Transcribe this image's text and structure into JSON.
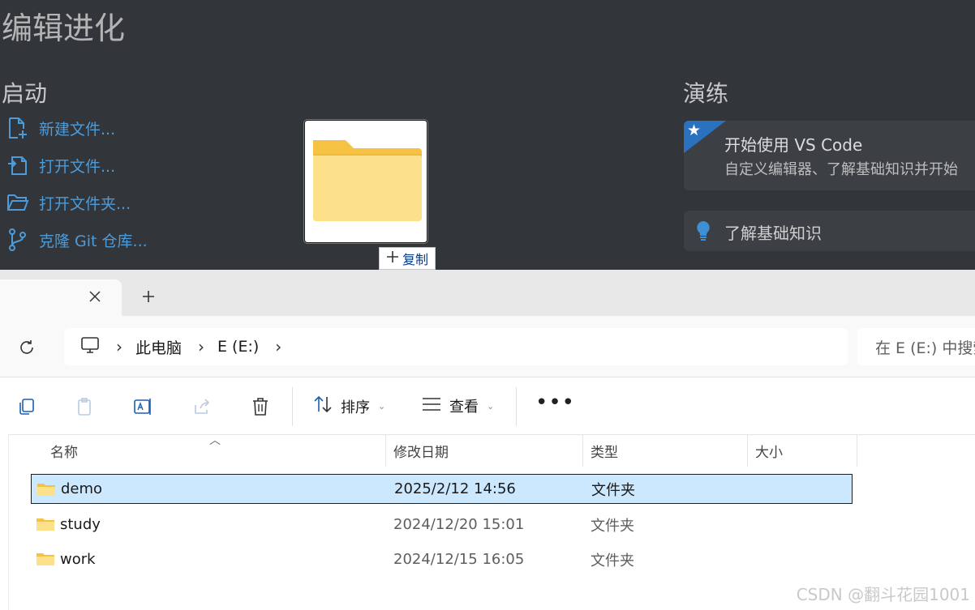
{
  "vscode": {
    "title": "编辑进化",
    "start_heading": "启动",
    "start_items": [
      {
        "label": "新建文件...",
        "icon": "new-file-icon"
      },
      {
        "label": "打开文件...",
        "icon": "open-file-icon"
      },
      {
        "label": "打开文件夹...",
        "icon": "open-folder-icon"
      },
      {
        "label": "克隆 Git 仓库...",
        "icon": "git-branch-icon"
      }
    ],
    "walkthrough_heading": "演练",
    "walkthrough_card": {
      "title": "开始使用 VS Code",
      "description": "自定义编辑器、了解基础知识并开始"
    },
    "walkthrough_card2": {
      "title": "了解基础知识"
    },
    "drag_copy_label": "复制",
    "link_color": "#4d9bd8",
    "background": "#32363b"
  },
  "explorer": {
    "breadcrumb": [
      "此电脑",
      "E (E:)"
    ],
    "search_placeholder": "在 E (E:) 中搜索",
    "toolbar": {
      "sort_label": "排序",
      "view_label": "查看",
      "icons": [
        "copy-icon",
        "paste-icon",
        "rename-icon",
        "share-icon",
        "delete-icon",
        "sort-icon",
        "view-icon",
        "more-icon"
      ]
    },
    "columns": [
      "名称",
      "修改日期",
      "类型",
      "大小"
    ],
    "rows": [
      {
        "name": "demo",
        "date": "2025/2/12 14:56",
        "type": "文件夹",
        "selected": true
      },
      {
        "name": "study",
        "date": "2024/12/20 15:01",
        "type": "文件夹",
        "selected": false
      },
      {
        "name": "work",
        "date": "2024/12/15 16:05",
        "type": "文件夹",
        "selected": false
      }
    ],
    "selection_color": "#cce8ff"
  },
  "watermark": "CSDN @翻斗花园1001"
}
